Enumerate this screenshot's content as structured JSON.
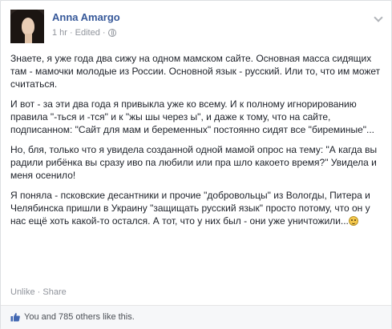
{
  "post": {
    "author": "Anna Amargo",
    "time": "1 hr",
    "edited": "Edited",
    "paragraphs": [
      "Знаете, я уже года два сижу на одном мамском сайте. Основная масса сидящих там - мамочки молодые из России. Основной язык - русский. Или то, что им может считаться.",
      "И вот - за эти два года я привыкла уже ко всему. И к полному игнорированию правила \"-ться и -тся\" и к \"жы шы через ы\", и даже к тому, что на сайте, подписанном: \"Сайт для мам и беременных\" постоянно сидят все \"биреминые\"...",
      "Но, бля, только что я увидела созданной одной мамой опрос на тему: \"А кагда вы радили рибёнка вы сразу иво па любили или пра шло какоето время?\" Увидела и меня осенило!",
      "Я поняла - псковские десантники и прочие \"добровольцы\" из Вологды, Питера и Челябинска пришли в Украину \"защищать русский язык\" просто потому, что он у нас ещё хоть какой-то остался. А тот, что у них был - они уже уничтожили..."
    ],
    "actions": {
      "unlike": "Unlike",
      "separator": "·",
      "share": "Share"
    },
    "likes_text": "You and 785 others like this."
  },
  "icons": {
    "globe": "globe-icon",
    "chevron": "chevron-down-icon",
    "thumb": "thumbs-up-icon",
    "smiley": "smiley-icon"
  },
  "colors": {
    "link": "#365899",
    "meta": "#90949c",
    "text": "#1d2129",
    "like_thumb": "#4267b2"
  }
}
